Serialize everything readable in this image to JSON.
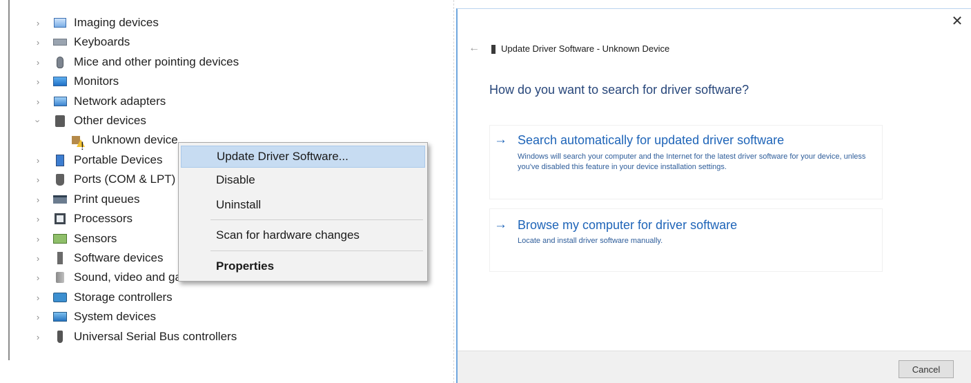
{
  "device_manager": {
    "items": [
      {
        "label": "Imaging devices",
        "icon": "camera-icon"
      },
      {
        "label": "Keyboards",
        "icon": "keyboard-icon"
      },
      {
        "label": "Mice and other pointing devices",
        "icon": "mouse-icon"
      },
      {
        "label": "Monitors",
        "icon": "monitor-icon"
      },
      {
        "label": "Network adapters",
        "icon": "network-adapter-icon"
      },
      {
        "label": "Other devices",
        "icon": "other-devices-icon",
        "expanded": true
      },
      {
        "label": "Unknown device",
        "icon": "unknown-device-warning-icon",
        "child": true
      },
      {
        "label": "Portable Devices",
        "icon": "portable-device-icon"
      },
      {
        "label": "Ports (COM & LPT)",
        "icon": "port-icon"
      },
      {
        "label": "Print queues",
        "icon": "printer-icon"
      },
      {
        "label": "Processors",
        "icon": "processor-icon"
      },
      {
        "label": "Sensors",
        "icon": "sensor-icon"
      },
      {
        "label": "Software devices",
        "icon": "software-device-icon"
      },
      {
        "label": "Sound, video and game controllers",
        "icon": "speaker-icon"
      },
      {
        "label": "Storage controllers",
        "icon": "storage-controller-icon"
      },
      {
        "label": "System devices",
        "icon": "system-devices-icon"
      },
      {
        "label": "Universal Serial Bus controllers",
        "icon": "usb-icon"
      }
    ]
  },
  "context_menu": {
    "update": "Update Driver Software...",
    "disable": "Disable",
    "uninstall": "Uninstall",
    "scan": "Scan for hardware changes",
    "properties": "Properties"
  },
  "dialog": {
    "close_glyph": "✕",
    "back_glyph": "←",
    "title": "Update Driver Software - Unknown Device",
    "question": "How do you want to search for driver software?",
    "option_auto": {
      "title": "Search automatically for updated driver software",
      "description": "Windows will search your computer and the Internet for the latest driver software for your device, unless you've disabled this feature in your device installation settings."
    },
    "option_browse": {
      "title": "Browse my computer for driver software",
      "description": "Locate and install driver software manually."
    },
    "arrow_glyph": "→",
    "cancel": "Cancel"
  }
}
